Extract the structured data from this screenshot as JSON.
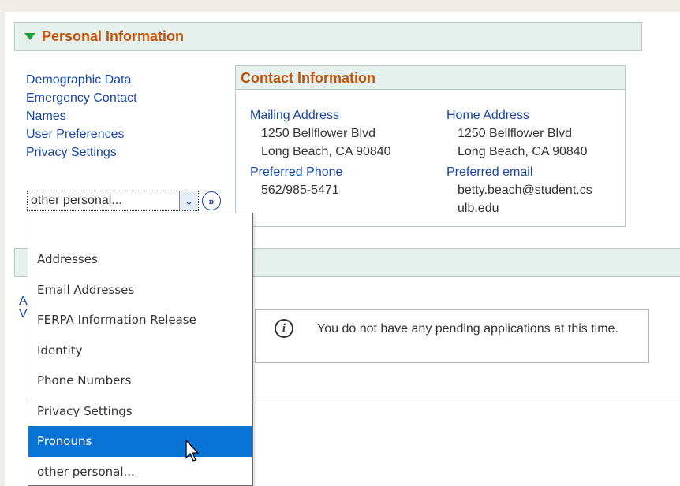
{
  "header": {
    "title": "Personal Information"
  },
  "links": [
    "Demographic Data",
    "Emergency Contact",
    "Names",
    "User Preferences",
    "Privacy Settings"
  ],
  "contact": {
    "title": "Contact Information",
    "mailing_label": "Mailing Address",
    "mailing_line1": "1250 Bellflower Blvd",
    "mailing_line2": "Long Beach, CA 90840",
    "home_label": "Home Address",
    "home_line1": "1250 Bellflower Blvd",
    "home_line2": "Long Beach, CA 90840",
    "phone_label": "Preferred Phone",
    "phone_value": "562/985-5471",
    "email_label": "Preferred email",
    "email_line1": "betty.beach@student.cs",
    "email_line2": "ulb.edu"
  },
  "select": {
    "value": "other personal...",
    "go_icon": "double-chevron-right-icon"
  },
  "section2": {
    "partial_a": "A",
    "partial_v": "V"
  },
  "message": {
    "text": "You do not have any pending applications at this time.",
    "icon": "info-icon"
  },
  "dropdown": {
    "options": [
      "Addresses",
      "Email Addresses",
      "FERPA Information Release",
      "Identity",
      "Phone Numbers",
      "Privacy Settings",
      "Pronouns",
      "other personal..."
    ],
    "highlighted": "Pronouns"
  },
  "colors": {
    "accent": "#c1550f",
    "link": "#1846a8",
    "header_bg": "#e6f0ec",
    "highlight": "#0a74d6"
  }
}
